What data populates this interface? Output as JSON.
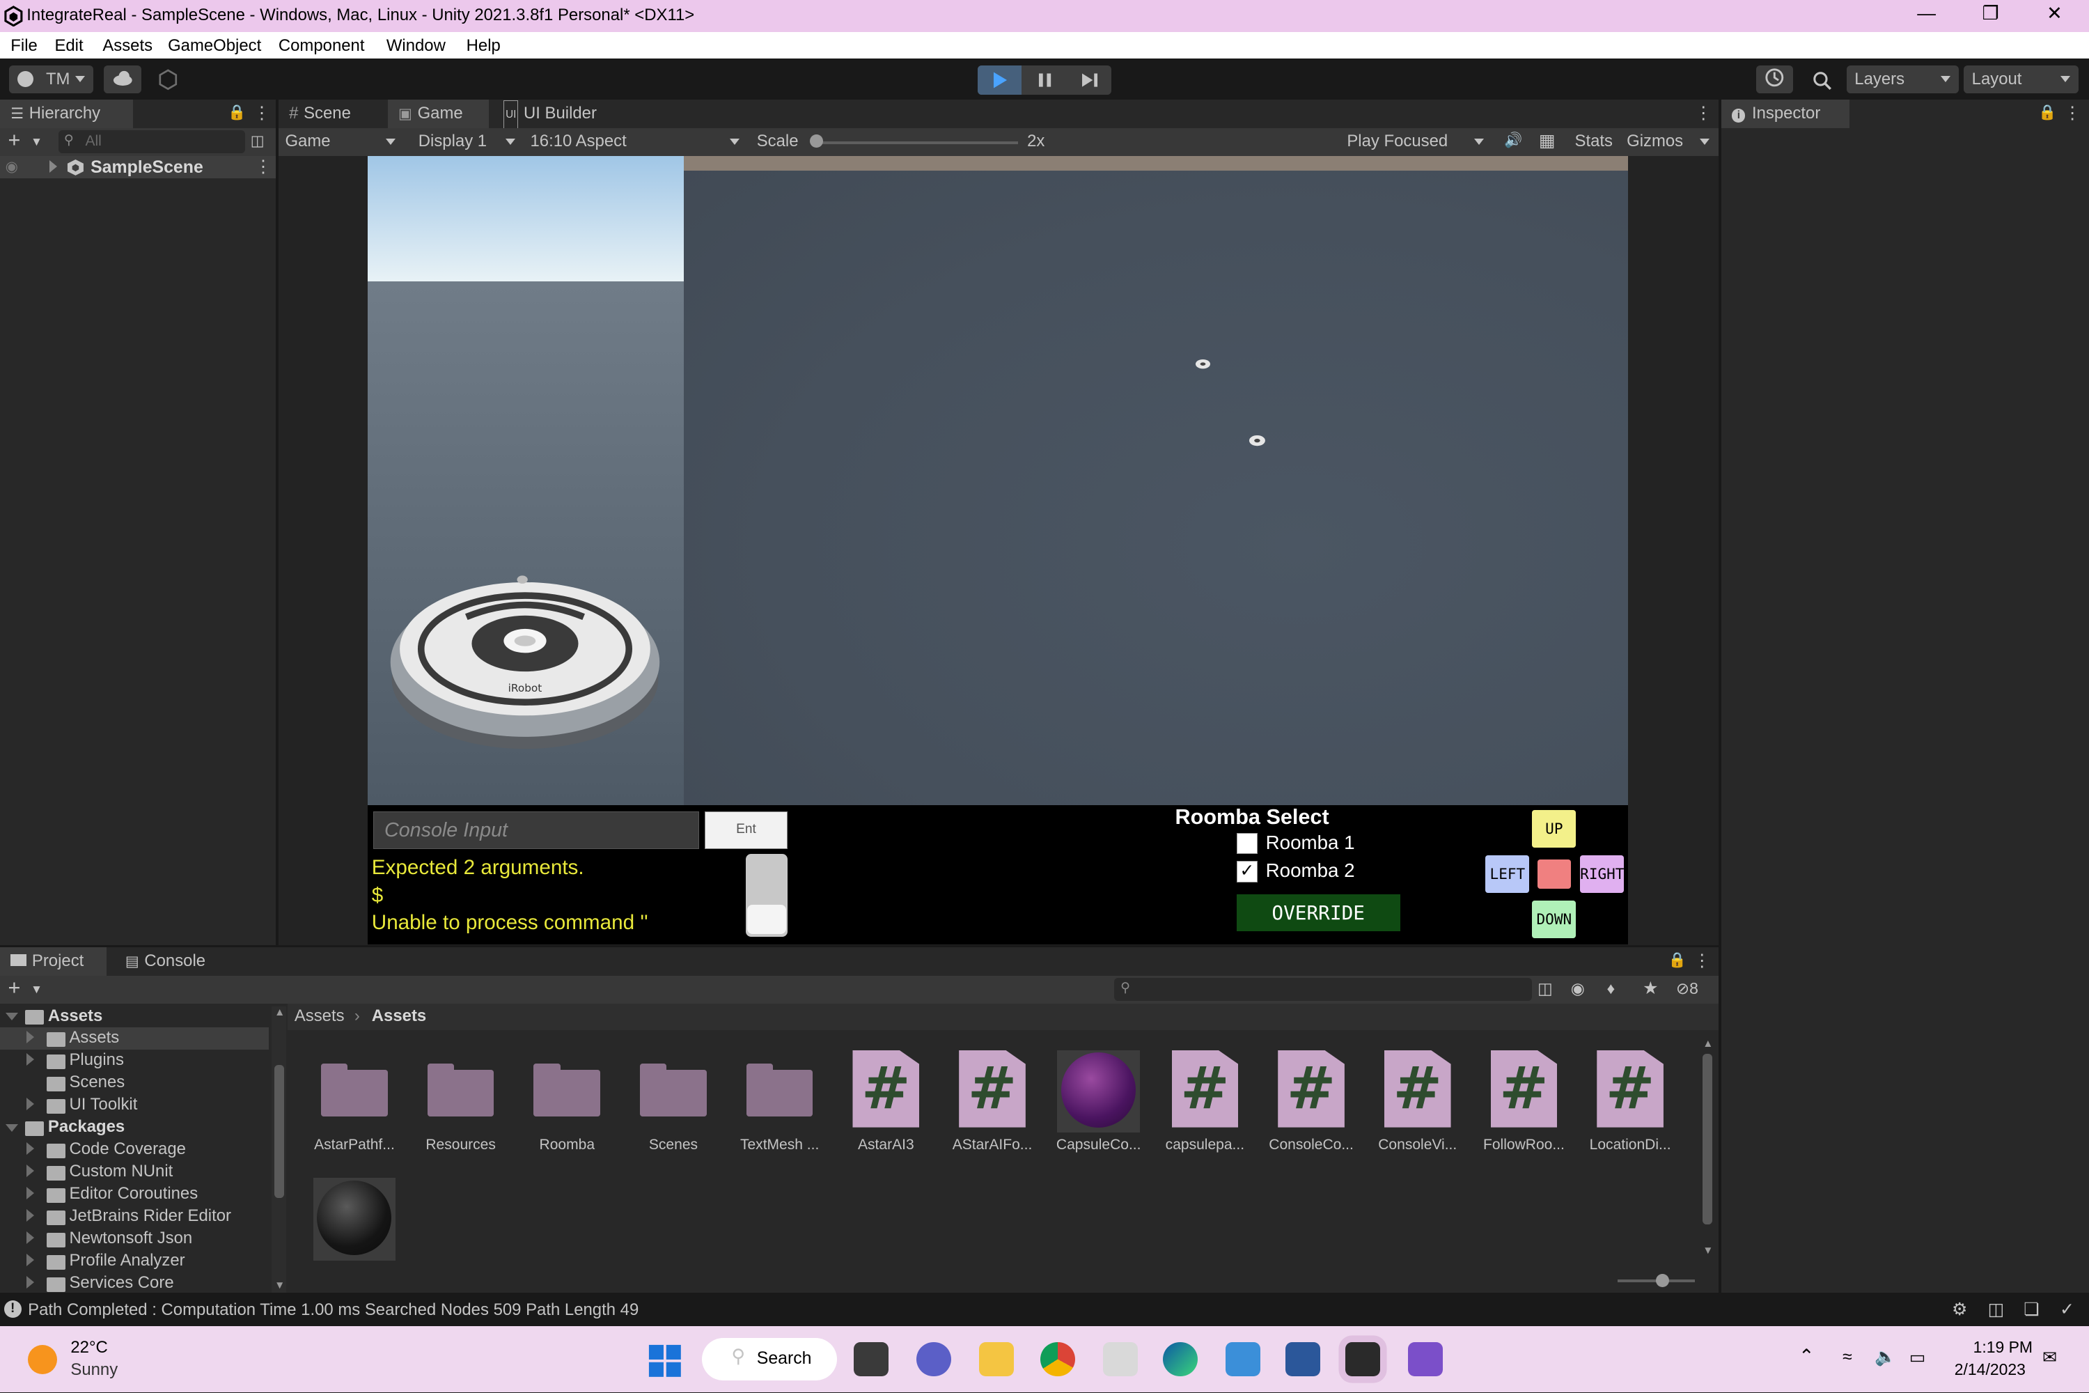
{
  "window": {
    "title": "IntegrateReal - SampleScene - Windows, Mac, Linux - Unity 2021.3.8f1 Personal* <DX11>"
  },
  "menu": [
    "File",
    "Edit",
    "Assets",
    "GameObject",
    "Component",
    "Window",
    "Help"
  ],
  "toolbar": {
    "account": "TM",
    "layers": "Layers",
    "layout": "Layout"
  },
  "hierarchy": {
    "tab": "Hierarchy",
    "search_placeholder": "All",
    "scene": "SampleScene"
  },
  "center_tabs": [
    "Scene",
    "Game",
    "UI Builder"
  ],
  "game_bar": {
    "view": "Game",
    "display": "Display 1",
    "aspect": "16:10 Aspect",
    "scale_label": "Scale",
    "scale_value": "2x",
    "play_mode": "Play Focused",
    "stats": "Stats",
    "gizmos": "Gizmos"
  },
  "game_ui": {
    "console_placeholder": "Console Input",
    "enter_label": "Ent",
    "log_lines": [
      "Expected 2 arguments.",
      "$",
      "Unable to process command ''"
    ],
    "roomba_select_title": "Roomba Select",
    "roombas": [
      {
        "label": "Roomba 1",
        "checked": false
      },
      {
        "label": "Roomba 2",
        "checked": true
      }
    ],
    "override": "OVERRIDE",
    "dirs": {
      "up": "UP",
      "left": "LEFT",
      "right": "RIGHT",
      "down": "DOWN"
    },
    "robot_brand": "iRobot",
    "colors": {
      "up": "#f3f08a",
      "left": "#b8c8f8",
      "right": "#e0b0f0",
      "down": "#b0f0b8",
      "stop": "#f08080",
      "override_bg": "#0f4a12"
    }
  },
  "inspector": {
    "tab": "Inspector"
  },
  "bottom_tabs": [
    "Project",
    "Console"
  ],
  "hidden_count": "8",
  "project_tree": [
    {
      "label": "Assets",
      "level": 0,
      "bold": true,
      "open": true
    },
    {
      "label": "Assets",
      "level": 1,
      "selected": true
    },
    {
      "label": "Plugins",
      "level": 1
    },
    {
      "label": "Scenes",
      "level": 1
    },
    {
      "label": "UI Toolkit",
      "level": 1
    },
    {
      "label": "Packages",
      "level": 0,
      "bold": true,
      "open": true
    },
    {
      "label": "Code Coverage",
      "level": 1
    },
    {
      "label": "Custom NUnit",
      "level": 1
    },
    {
      "label": "Editor Coroutines",
      "level": 1
    },
    {
      "label": "JetBrains Rider Editor",
      "level": 1
    },
    {
      "label": "Newtonsoft Json",
      "level": 1
    },
    {
      "label": "Profile Analyzer",
      "level": 1
    },
    {
      "label": "Services Core",
      "level": 1
    }
  ],
  "breadcrumb": [
    "Assets",
    "Assets"
  ],
  "assets": [
    {
      "label": "AstarPathf...",
      "kind": "folder"
    },
    {
      "label": "Resources",
      "kind": "folder"
    },
    {
      "label": "Roomba",
      "kind": "folder"
    },
    {
      "label": "Scenes",
      "kind": "folder"
    },
    {
      "label": "TextMesh ...",
      "kind": "folder"
    },
    {
      "label": "AstarAI3",
      "kind": "script"
    },
    {
      "label": "AStarAIFo...",
      "kind": "script"
    },
    {
      "label": "CapsuleCo...",
      "kind": "material"
    },
    {
      "label": "capsulepa...",
      "kind": "script"
    },
    {
      "label": "ConsoleCo...",
      "kind": "script"
    },
    {
      "label": "ConsoleVi...",
      "kind": "script"
    },
    {
      "label": "FollowRoo...",
      "kind": "script"
    },
    {
      "label": "LocationDi...",
      "kind": "script"
    },
    {
      "label": "",
      "kind": "material-dark"
    }
  ],
  "status": "Path Completed : Computation Time 1.00 ms Searched Nodes 509 Path Length 49",
  "taskbar": {
    "temp": "22°C",
    "weather": "Sunny",
    "search": "Search",
    "time": "1:19 PM",
    "date": "2/14/2023"
  }
}
